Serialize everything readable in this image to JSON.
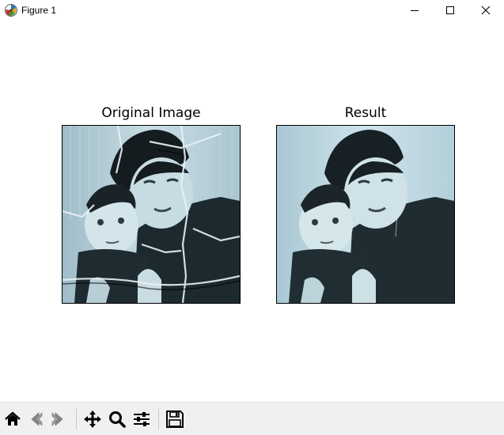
{
  "window": {
    "title": "Figure 1",
    "icons": {
      "app": "matplotlib-logo-icon",
      "minimize": "minimize-icon",
      "maximize": "maximize-icon",
      "close": "close-icon"
    }
  },
  "figure": {
    "subplots": [
      {
        "title": "Original Image",
        "content": "damaged vintage photograph of a woman and a young child"
      },
      {
        "title": "Result",
        "content": "restored photograph of the same woman and child"
      }
    ]
  },
  "toolbar": {
    "buttons": [
      {
        "icon": "home-icon",
        "enabled": true
      },
      {
        "icon": "back-arrow-icon",
        "enabled": false
      },
      {
        "icon": "forward-arrow-icon",
        "enabled": false
      },
      {
        "icon": "pan-icon",
        "enabled": true
      },
      {
        "icon": "zoom-icon",
        "enabled": true
      },
      {
        "icon": "configure-subplots-icon",
        "enabled": true
      },
      {
        "icon": "save-icon",
        "enabled": true
      }
    ]
  }
}
